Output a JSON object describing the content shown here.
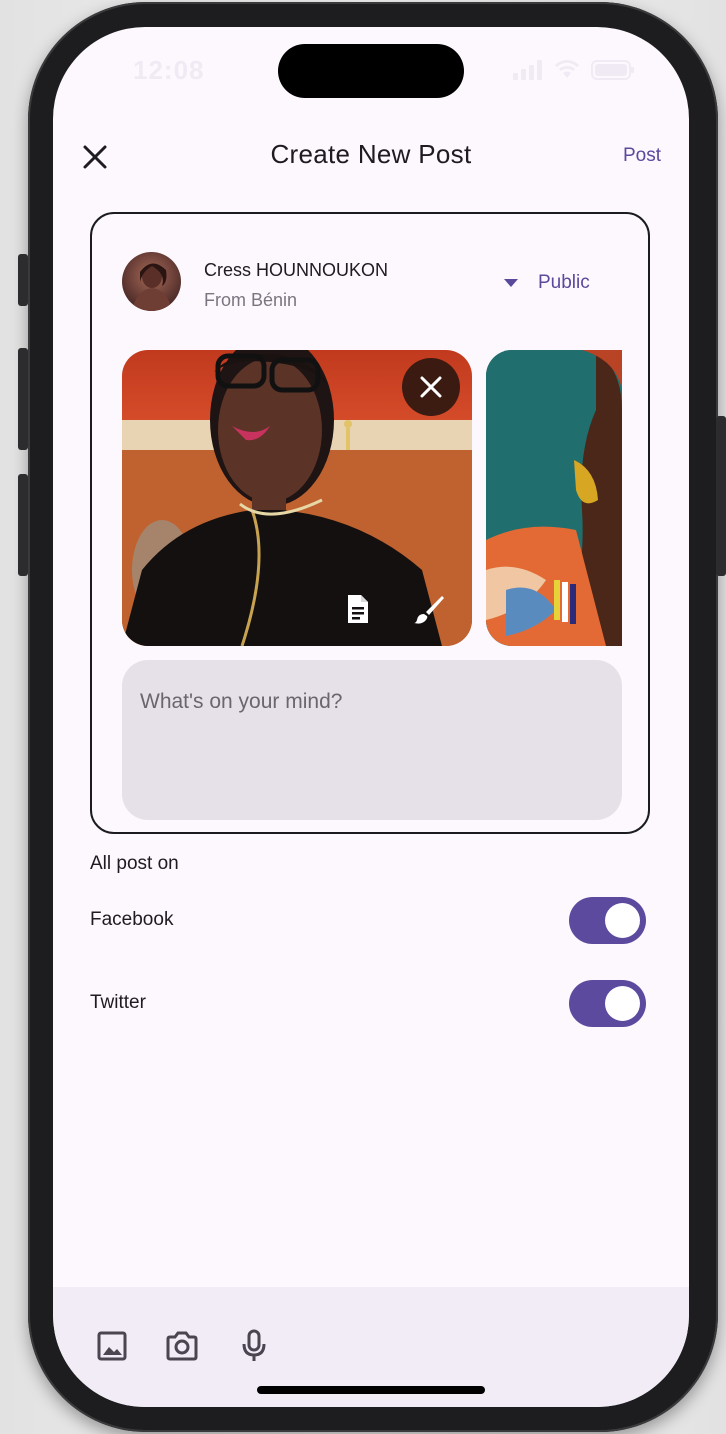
{
  "status_bar": {
    "time": "12:08"
  },
  "header": {
    "title": "Create New Post",
    "post_label": "Post"
  },
  "author": {
    "name": "Cress HOUNNOUKON",
    "origin": "From Bénin"
  },
  "privacy": {
    "value": "Public"
  },
  "composer": {
    "placeholder": "What's on your mind?"
  },
  "share": {
    "heading": "All post on",
    "targets": [
      {
        "label": "Facebook",
        "enabled": true
      },
      {
        "label": "Twitter",
        "enabled": true
      }
    ]
  },
  "colors": {
    "accent": "#5b4a9e",
    "background": "#fcf8fd",
    "composer_bg": "#e6e1e8",
    "bottom_bar": "#f1ecf5"
  },
  "icons": {
    "close": "close-icon",
    "dropdown": "arrow-drop-down-icon",
    "remove_photo": "close-icon",
    "photo_tools": [
      "document-icon",
      "brush-icon"
    ],
    "bottom_tools": [
      "image-icon",
      "camera-icon",
      "microphone-icon"
    ]
  }
}
